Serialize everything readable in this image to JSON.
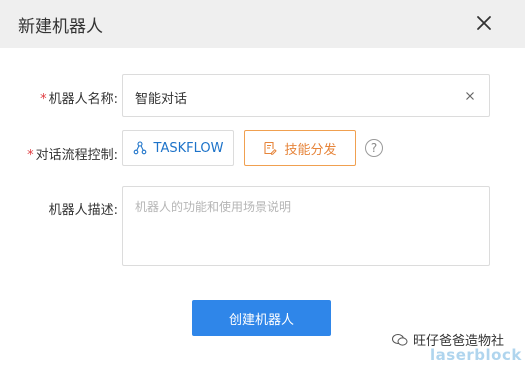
{
  "dialog": {
    "title": "新建机器人",
    "close_icon": "close-icon"
  },
  "form": {
    "required_mark": "*",
    "name": {
      "label": "机器人名称:",
      "value": "智能对话",
      "clear_icon": "clear-x-icon"
    },
    "flow_control": {
      "label": "对话流程控制:",
      "options": [
        {
          "label": "TASKFLOW",
          "icon": "flow-nodes-icon",
          "selected": false
        },
        {
          "label": "技能分发",
          "icon": "skill-doc-icon",
          "selected": true
        }
      ],
      "help_icon": "?"
    },
    "description": {
      "label": "机器人描述:",
      "value": "",
      "placeholder": "机器人的功能和使用场景说明"
    },
    "submit_label": "创建机器人"
  },
  "watermark": {
    "account": "旺仔爸爸造物社",
    "brand": "laserblock"
  },
  "colors": {
    "header_bg": "#efefef",
    "primary": "#2f86e9",
    "required": "#e0393e",
    "taskflow_text": "#1d73c9",
    "skill_accent": "#e6843a"
  }
}
